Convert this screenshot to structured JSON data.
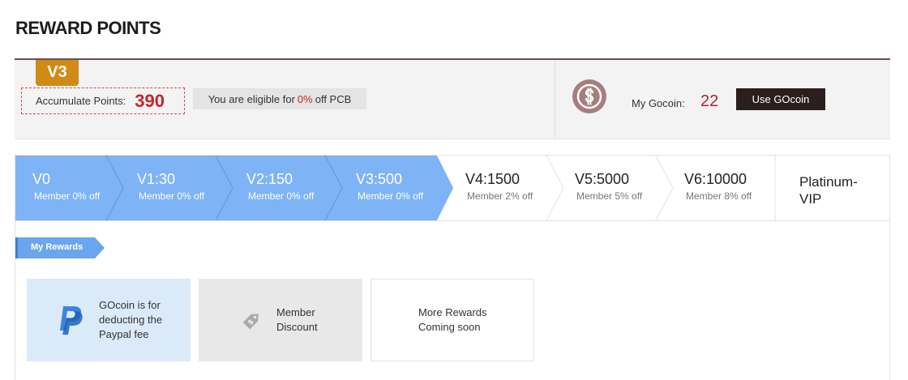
{
  "page": {
    "title": "REWARD POINTS"
  },
  "summary": {
    "level_badge": "V3",
    "points_label": "Accumulate Points:",
    "points_value": "390",
    "eligible_prefix": "You are eligible for",
    "eligible_pct": "0%",
    "eligible_suffix": "off PCB",
    "gocoin_label": "My Gocoin:",
    "gocoin_value": "22",
    "use_button": "Use GOcoin"
  },
  "levels": [
    {
      "name": "V0",
      "discount": "Member 0% off",
      "active": true
    },
    {
      "name": "V1:30",
      "discount": "Member 0% off",
      "active": true
    },
    {
      "name": "V2:150",
      "discount": "Member 0% off",
      "active": true
    },
    {
      "name": "V3:500",
      "discount": "Member 0% off",
      "active": true
    },
    {
      "name": "V4:1500",
      "discount": "Member 2% off",
      "active": false
    },
    {
      "name": "V5:5000",
      "discount": "Member 5% off",
      "active": false
    },
    {
      "name": "V6:10000",
      "discount": "Member 8% off",
      "active": false
    }
  ],
  "platinum": {
    "line1": "Platinum-",
    "line2": "VIP"
  },
  "rewards": {
    "tab_label": "My Rewards",
    "cards": [
      {
        "icon": "paypal-icon",
        "line1": "GOcoin is for",
        "line2": "deducting the",
        "line3": "Paypal fee"
      },
      {
        "icon": "discount-tag-icon",
        "line1": "Member",
        "line2": "Discount"
      },
      {
        "line1": "More Rewards",
        "line2": "Coming soon"
      }
    ]
  },
  "colors": {
    "accent_blue": "#7eb3f6",
    "badge_orange": "#d08a15",
    "points_red": "#c3252b",
    "header_rule": "#6b4f4c",
    "button_dark": "#2a1e1e"
  }
}
